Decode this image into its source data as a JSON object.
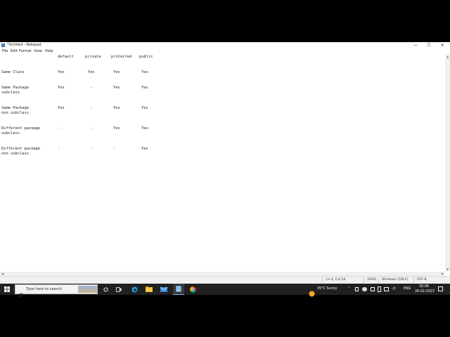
{
  "window": {
    "title": "*Untitled - Notepad",
    "controls": {
      "minimize": "—",
      "maximize": "☐",
      "close": "✕"
    }
  },
  "menu": [
    "File",
    "Edit",
    "Format",
    "View",
    "Help"
  ],
  "editor": {
    "headers": [
      "default",
      "private",
      "protected",
      "public"
    ],
    "rows": [
      {
        "label": [
          "Same Class"
        ],
        "values": [
          "Yes",
          "Yes",
          "Yes",
          "Yes"
        ]
      },
      {
        "label": [
          "Same Package",
          "subclass"
        ],
        "values": [
          "Yes",
          "-",
          "Yes",
          "Yes"
        ]
      },
      {
        "label": [
          "Same Package",
          "non subclass"
        ],
        "values": [
          "Yes",
          "-",
          "Yes",
          "Yes"
        ]
      },
      {
        "label": [
          "Different package",
          "subclass"
        ],
        "values": [
          "-",
          "-",
          "Yes",
          "Yes"
        ]
      },
      {
        "label": [
          "Different package",
          "non subclass"
        ],
        "values": [
          "-",
          "-",
          "-",
          "Yes"
        ]
      }
    ]
  },
  "status": {
    "position": "Ln 4, Col 24",
    "zoom": "100%",
    "line_ending": "Windows (CRLF)",
    "encoding": "UTF-8"
  },
  "taskbar": {
    "search_placeholder": "Type here to search",
    "weather": "35°C  Sunny",
    "language": "ENG",
    "time": "16:06",
    "date": "26-02-2023",
    "colors": {
      "bar": "#202020",
      "accent": "#0078d4"
    }
  }
}
